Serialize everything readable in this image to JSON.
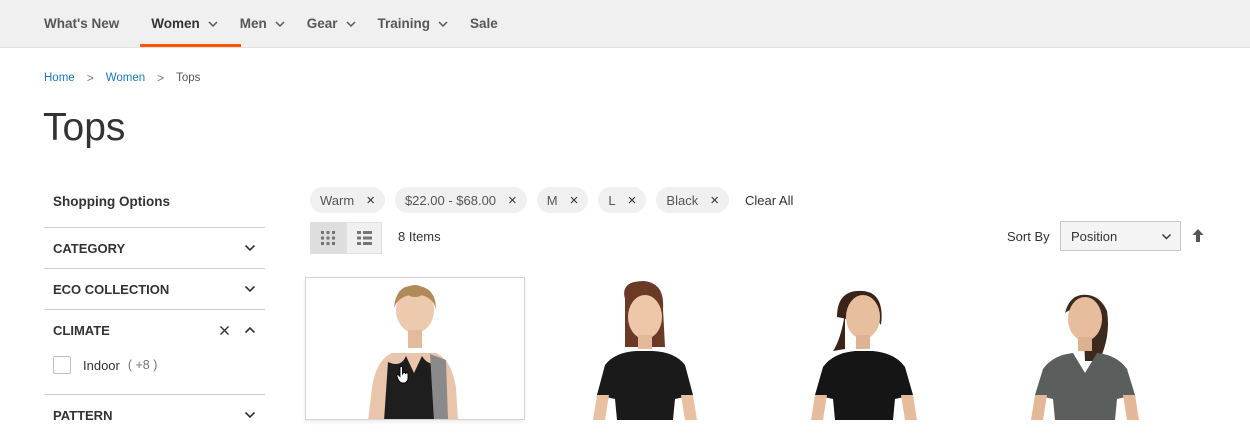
{
  "nav": {
    "items": [
      {
        "label": "What's New",
        "has_submenu": false,
        "active": false
      },
      {
        "label": "Women",
        "has_submenu": true,
        "active": true
      },
      {
        "label": "Men",
        "has_submenu": true,
        "active": false
      },
      {
        "label": "Gear",
        "has_submenu": true,
        "active": false
      },
      {
        "label": "Training",
        "has_submenu": true,
        "active": false
      },
      {
        "label": "Sale",
        "has_submenu": false,
        "active": false
      }
    ],
    "accent_color": "#ff5501"
  },
  "breadcrumb": {
    "home": "Home",
    "sep1": ">",
    "women": "Women",
    "sep2": ">",
    "current": "Tops"
  },
  "page_title": "Tops",
  "sidebar": {
    "title": "Shopping Options",
    "filters": [
      {
        "label": "CATEGORY",
        "expanded": false
      },
      {
        "label": "ECO COLLECTION",
        "expanded": false
      },
      {
        "label": "CLIMATE",
        "expanded": true,
        "clearable": true
      },
      {
        "label": "PATTERN",
        "expanded": false
      }
    ],
    "climate_option": {
      "label": "Indoor",
      "count": "( +8 )"
    }
  },
  "active_filters": {
    "chips": [
      "Warm",
      "$22.00 - $68.00",
      "M",
      "L",
      "Black"
    ],
    "remove_icon": "×",
    "clear_all": "Clear All"
  },
  "toolbar": {
    "view_modes": [
      {
        "icon": "grid-icon",
        "active": true
      },
      {
        "icon": "list-icon",
        "active": false
      }
    ],
    "items_count": "8 Items",
    "sort_label": "Sort By",
    "sort_value": "Position",
    "sort_direction_icon": "arrow-up-icon"
  },
  "products": [
    {
      "icon": "woman-tank-top-image",
      "top_color": "#1e1e1e",
      "accent_color": "#8a8a8a",
      "hair": "#b08a58"
    },
    {
      "icon": "woman-black-tee-image",
      "top_color": "#1a1a1a",
      "accent_color": "#1a1a1a",
      "hair": "#6b3a26"
    },
    {
      "icon": "woman-black-tee-image",
      "top_color": "#151515",
      "accent_color": "#151515",
      "hair": "#3a2418"
    },
    {
      "icon": "woman-grey-vneck-image",
      "top_color": "#5a5e5c",
      "accent_color": "#4b4f4d",
      "hair": "#3c2a1e"
    }
  ]
}
